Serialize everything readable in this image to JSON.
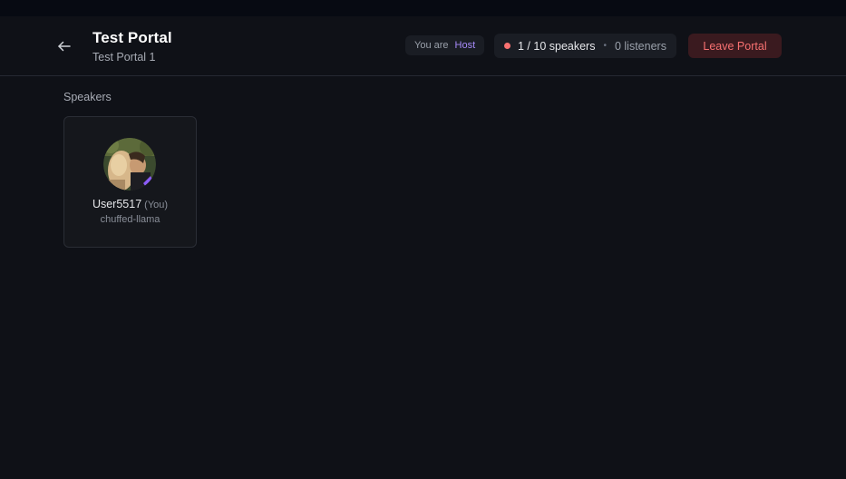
{
  "header": {
    "title": "Test Portal",
    "subtitle": "Test Portal 1",
    "back_icon": "arrow-left-icon"
  },
  "role": {
    "prefix": "You are",
    "value": "Host",
    "color": "#a78bfa"
  },
  "counts": {
    "speakers": "1 / 10 speakers",
    "separator": "•",
    "listeners": "0 listeners",
    "live_dot_color": "#f87171"
  },
  "leave_button": {
    "label": "Leave Portal",
    "color": "#f87171"
  },
  "speakers_section": {
    "label": "Speakers",
    "speakers": [
      {
        "name": "User5517",
        "self_tag": "(You)",
        "handle": "chuffed-llama",
        "avatar": "user-photo-avatar"
      }
    ]
  }
}
